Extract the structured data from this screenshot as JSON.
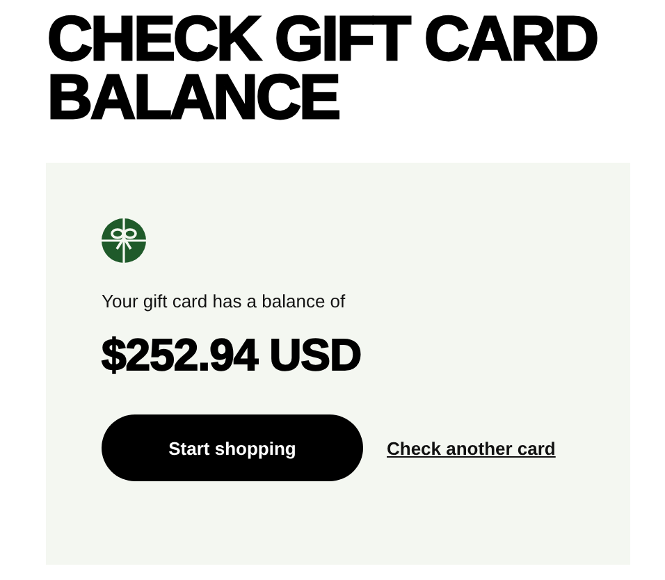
{
  "title": "CHECK GIFT CARD BALANCE",
  "balance_card": {
    "message": "Your gift card has a balance of",
    "amount": "$252.94 USD",
    "primary_button": "Start shopping",
    "link": "Check another card"
  }
}
